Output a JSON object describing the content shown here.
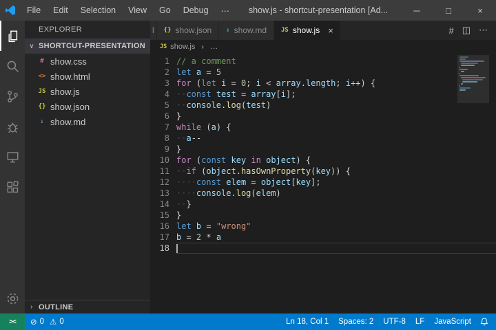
{
  "colors": {
    "accent": "#007acc",
    "status_bar_bg": "#007acc",
    "remote_bg": "#16825d",
    "title_bar_bg": "#3c3c3c",
    "activity_bar_bg": "#333333",
    "sidebar_bg": "#252526",
    "editor_bg": "#1e1e1e",
    "tab_inactive_bg": "#2d2d2d",
    "syntax": {
      "cm": "#6a9955",
      "kw": "#569cd6",
      "ctrl": "#c586c0",
      "var": "#9cdcfe",
      "num": "#b5cea8",
      "str": "#ce9178",
      "fn": "#dcdcaa",
      "pun": "#d4d4d4",
      "ws": "#4d4d4d"
    }
  },
  "window": {
    "menus": [
      "File",
      "Edit",
      "Selection",
      "View",
      "Go",
      "Debug",
      "⋯"
    ],
    "title": "show.js - shortcut-presentation [Ad...",
    "controls": {
      "minimize": "─",
      "maximize": "□",
      "close": "×"
    }
  },
  "activity_bar": {
    "items": [
      "explorer",
      "search",
      "source-control",
      "run-debug",
      "remote-explorer",
      "extensions"
    ],
    "active": "explorer",
    "bottom": [
      "settings"
    ]
  },
  "sidebar": {
    "header": "EXPLORER",
    "folder": {
      "chevron": "∨",
      "label": "SHORTCUT-PRESENTATION"
    },
    "files": [
      {
        "icon": "#",
        "icon_color": "#c76b98",
        "name": "show.css"
      },
      {
        "icon": "<>",
        "icon_color": "#e37933",
        "name": "show.html"
      },
      {
        "icon": "JS",
        "icon_color": "#cbcb41",
        "name": "show.js"
      },
      {
        "icon": "{}",
        "icon_color": "#cbcb41",
        "name": "show.json"
      },
      {
        "icon": "↓",
        "icon_color": "#519aba",
        "name": "show.md"
      }
    ],
    "outline": {
      "chevron": "›",
      "label": "OUTLINE"
    }
  },
  "tabs": [
    {
      "label": "l",
      "partial": true,
      "active": false
    },
    {
      "icon": "{}",
      "icon_color": "#cbcb41",
      "label": "show.json",
      "active": false
    },
    {
      "icon": "↓",
      "icon_color": "#519aba",
      "label": "show.md",
      "active": false
    },
    {
      "icon": "JS",
      "icon_color": "#cbcb41",
      "label": "show.js",
      "active": true,
      "close": "×"
    }
  ],
  "editor_actions": [
    {
      "glyph": "#",
      "name": "symbols-action-icon"
    },
    {
      "glyph": "◫",
      "name": "split-editor-icon"
    },
    {
      "glyph": "⋯",
      "name": "more-actions-icon"
    }
  ],
  "breadcrumb": {
    "icon": "JS",
    "icon_color": "#cbcb41",
    "file": "show.js",
    "sep": "›",
    "tail": "…"
  },
  "editor": {
    "lines": [
      {
        "n": 1,
        "tokens": [
          [
            "cm",
            "// a comment"
          ]
        ]
      },
      {
        "n": 2,
        "tokens": [
          [
            "kw",
            "let"
          ],
          [
            "pun",
            " "
          ],
          [
            "var",
            "a"
          ],
          [
            "pun",
            " = "
          ],
          [
            "num",
            "5"
          ]
        ]
      },
      {
        "n": 3,
        "tokens": [
          [
            "ctrl",
            "for"
          ],
          [
            "pun",
            " ("
          ],
          [
            "kw",
            "let"
          ],
          [
            "pun",
            " "
          ],
          [
            "var",
            "i"
          ],
          [
            "pun",
            " = "
          ],
          [
            "num",
            "0"
          ],
          [
            "pun",
            "; "
          ],
          [
            "var",
            "i"
          ],
          [
            "pun",
            " < "
          ],
          [
            "var",
            "array"
          ],
          [
            "pun",
            "."
          ],
          [
            "var",
            "length"
          ],
          [
            "pun",
            "; "
          ],
          [
            "var",
            "i"
          ],
          [
            "pun",
            "++) {"
          ]
        ]
      },
      {
        "n": 4,
        "tokens": [
          [
            "ws",
            "··"
          ],
          [
            "kw",
            "const"
          ],
          [
            "pun",
            " "
          ],
          [
            "var",
            "test"
          ],
          [
            "pun",
            " = "
          ],
          [
            "var",
            "array"
          ],
          [
            "pun",
            "["
          ],
          [
            "var",
            "i"
          ],
          [
            "pun",
            "];"
          ]
        ]
      },
      {
        "n": 5,
        "tokens": [
          [
            "ws",
            "··"
          ],
          [
            "var",
            "console"
          ],
          [
            "pun",
            "."
          ],
          [
            "fn",
            "log"
          ],
          [
            "pun",
            "("
          ],
          [
            "var",
            "test"
          ],
          [
            "pun",
            ")"
          ]
        ]
      },
      {
        "n": 6,
        "tokens": [
          [
            "pun",
            "}"
          ]
        ]
      },
      {
        "n": 7,
        "tokens": [
          [
            "ctrl",
            "while"
          ],
          [
            "pun",
            " ("
          ],
          [
            "var",
            "a"
          ],
          [
            "pun",
            ") {"
          ]
        ]
      },
      {
        "n": 8,
        "tokens": [
          [
            "ws",
            "··"
          ],
          [
            "var",
            "a"
          ],
          [
            "pun",
            "--"
          ]
        ]
      },
      {
        "n": 9,
        "tokens": [
          [
            "pun",
            "}"
          ]
        ]
      },
      {
        "n": 10,
        "tokens": [
          [
            "ctrl",
            "for"
          ],
          [
            "pun",
            " ("
          ],
          [
            "kw",
            "const"
          ],
          [
            "pun",
            " "
          ],
          [
            "var",
            "key"
          ],
          [
            "pun",
            " "
          ],
          [
            "ctrl",
            "in"
          ],
          [
            "pun",
            " "
          ],
          [
            "var",
            "object"
          ],
          [
            "pun",
            ") {"
          ]
        ]
      },
      {
        "n": 11,
        "tokens": [
          [
            "ws",
            "··"
          ],
          [
            "ctrl",
            "if"
          ],
          [
            "pun",
            " ("
          ],
          [
            "var",
            "object"
          ],
          [
            "pun",
            "."
          ],
          [
            "fn",
            "hasOwnProperty"
          ],
          [
            "pun",
            "("
          ],
          [
            "var",
            "key"
          ],
          [
            "pun",
            ")) {"
          ]
        ]
      },
      {
        "n": 12,
        "tokens": [
          [
            "ws",
            "····"
          ],
          [
            "kw",
            "const"
          ],
          [
            "pun",
            " "
          ],
          [
            "var",
            "elem"
          ],
          [
            "pun",
            " = "
          ],
          [
            "var",
            "object"
          ],
          [
            "pun",
            "["
          ],
          [
            "var",
            "key"
          ],
          [
            "pun",
            "];"
          ]
        ]
      },
      {
        "n": 13,
        "tokens": [
          [
            "ws",
            "····"
          ],
          [
            "var",
            "console"
          ],
          [
            "pun",
            "."
          ],
          [
            "fn",
            "log"
          ],
          [
            "pun",
            "("
          ],
          [
            "var",
            "elem"
          ],
          [
            "pun",
            ")"
          ]
        ]
      },
      {
        "n": 14,
        "tokens": [
          [
            "ws",
            "··"
          ],
          [
            "pun",
            "}"
          ]
        ]
      },
      {
        "n": 15,
        "tokens": [
          [
            "pun",
            "}"
          ]
        ]
      },
      {
        "n": 16,
        "tokens": [
          [
            "kw",
            "let"
          ],
          [
            "pun",
            " "
          ],
          [
            "var",
            "b"
          ],
          [
            "pun",
            " = "
          ],
          [
            "str",
            "\"wrong\""
          ]
        ]
      },
      {
        "n": 17,
        "tokens": [
          [
            "var",
            "b"
          ],
          [
            "pun",
            " = "
          ],
          [
            "num",
            "2"
          ],
          [
            "pun",
            " * "
          ],
          [
            "var",
            "a"
          ]
        ]
      },
      {
        "n": 18,
        "tokens": [],
        "current": true
      }
    ]
  },
  "status_bar": {
    "remote_icon": "><",
    "problems": {
      "errors_icon": "⊘",
      "errors": "0",
      "warnings_icon": "⚠",
      "warnings": "0"
    },
    "right_items": [
      "Ln 18, Col 1",
      "Spaces: 2",
      "UTF-8",
      "LF",
      "JavaScript"
    ],
    "bell_icon": "bell"
  }
}
